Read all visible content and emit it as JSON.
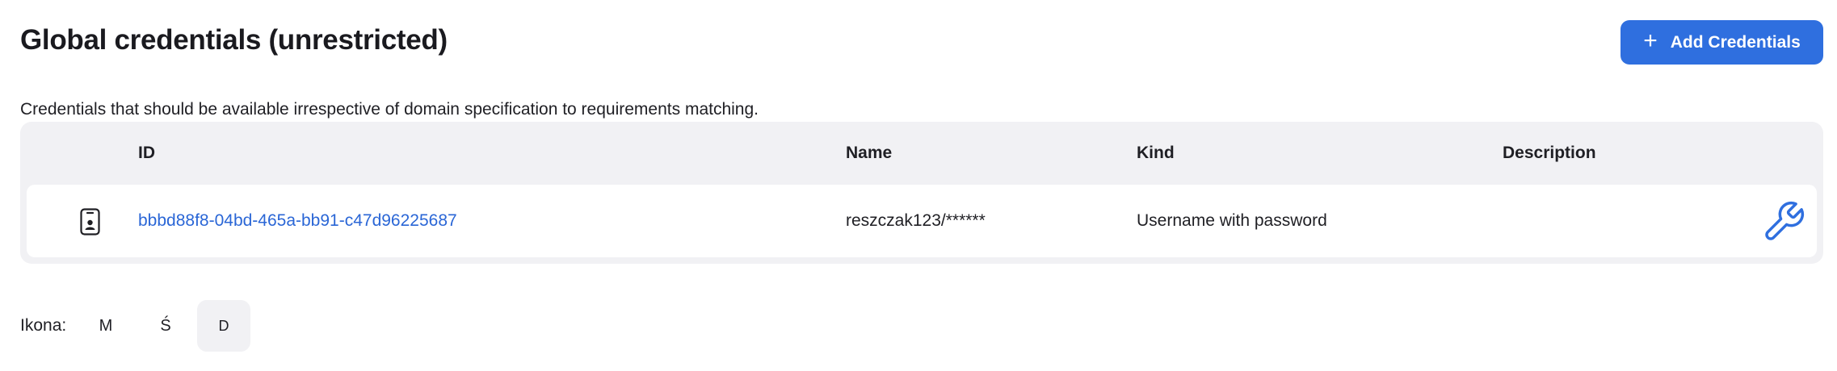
{
  "header": {
    "title": "Global credentials (unrestricted)",
    "add_button_label": "Add Credentials",
    "add_button_icon": "plus-icon"
  },
  "description": "Credentials that should be available irrespective of domain specification to requirements matching.",
  "table": {
    "columns": [
      "ID",
      "Name",
      "Kind",
      "Description"
    ],
    "rows": [
      {
        "icon": "credential-card-icon",
        "id": "bbbd88f8-04bd-465a-bb91-c47d96225687",
        "name": "reszczak123/******",
        "kind": "Username with password",
        "description": "",
        "action_icon": "wrench-icon"
      }
    ]
  },
  "icon_size": {
    "label": "Ikona:",
    "options": [
      "M",
      "Ś",
      "D"
    ],
    "selected": "D"
  },
  "colors": {
    "accent": "#2f6fdf",
    "link": "#2a66d6",
    "table_bg": "#f1f1f4"
  }
}
